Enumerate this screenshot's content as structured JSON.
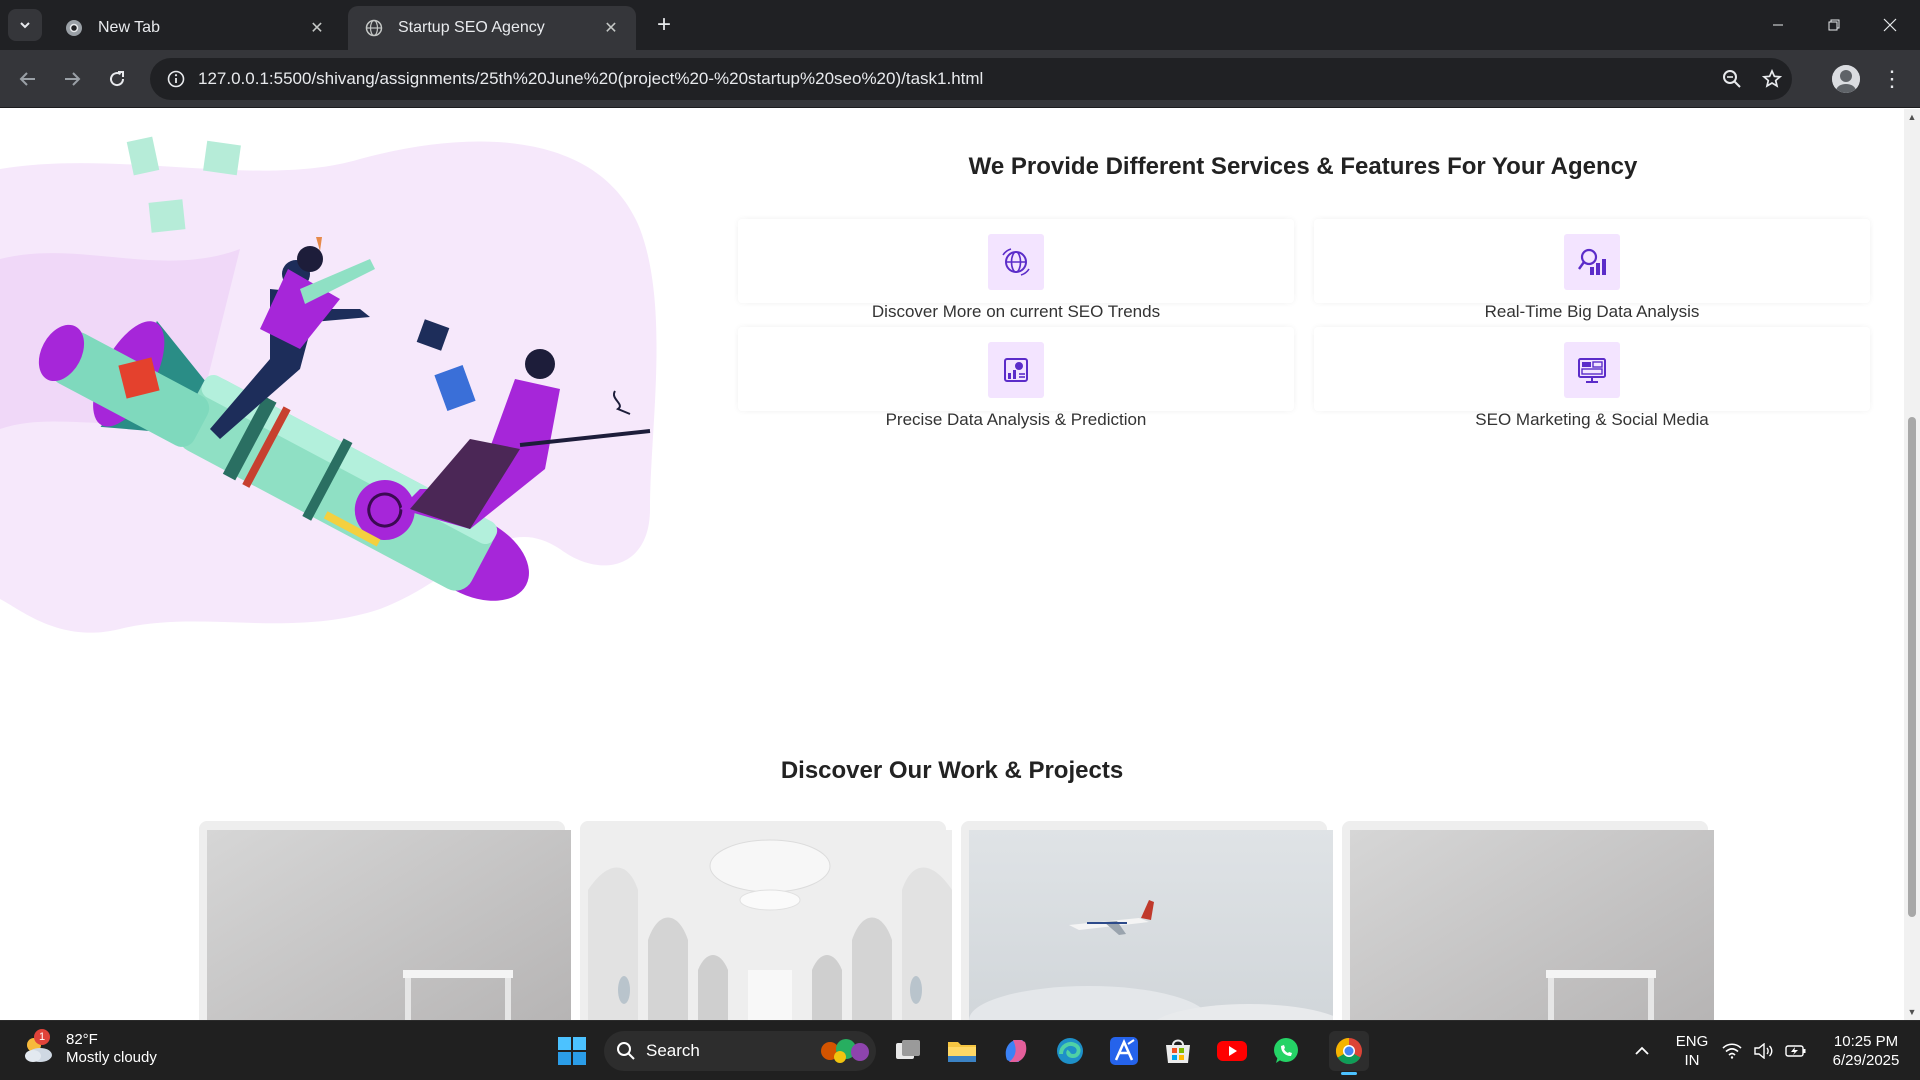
{
  "browser": {
    "tabs": [
      {
        "title": "New Tab",
        "active": false
      },
      {
        "title": "Startup SEO Agency",
        "active": true
      }
    ],
    "url": "127.0.0.1:5500/shivang/assignments/25th%20June%20(project%20-%20startup%20seo%20)/task1.html"
  },
  "page": {
    "services_title": "We Provide Different Services & Features For Your Agency",
    "services": [
      {
        "label": "Discover More on current SEO Trends",
        "icon": "globe-dollar-icon"
      },
      {
        "label": "Real-Time Big Data Analysis",
        "icon": "analytics-search-icon"
      },
      {
        "label": "Precise Data Analysis & Prediction",
        "icon": "chart-report-icon"
      },
      {
        "label": "SEO Marketing & Social Media",
        "icon": "monitor-ads-icon"
      }
    ],
    "work_title": "Discover Our Work & Projects",
    "projects": [
      {
        "image": "empty-room-image"
      },
      {
        "image": "white-hallway-image"
      },
      {
        "image": "airplane-sky-image"
      },
      {
        "image": "empty-room-image"
      }
    ],
    "accent_color": "#a020f0",
    "icon_bg_color": "#f3e4ff"
  },
  "taskbar": {
    "weather": {
      "temp": "82°F",
      "condition": "Mostly cloudy",
      "badge": "1"
    },
    "search_label": "Search",
    "language": {
      "line1": "ENG",
      "line2": "IN"
    },
    "clock": {
      "time": "10:25 PM",
      "date": "6/29/2025"
    }
  }
}
